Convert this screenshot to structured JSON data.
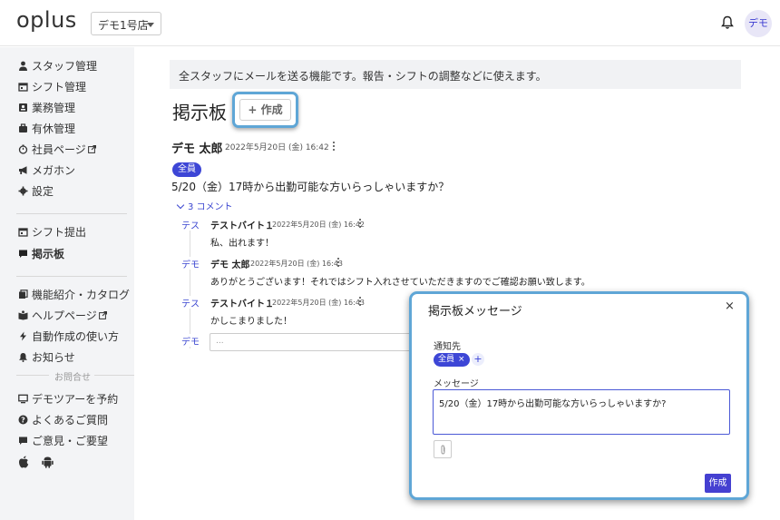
{
  "header": {
    "logo": "oplus",
    "store_select": "デモ1号店",
    "avatar": "デモ"
  },
  "sidebar": {
    "items_top": [
      {
        "label": "スタッフ管理",
        "icon": "person-icon"
      },
      {
        "label": "シフト管理",
        "icon": "calendar-icon"
      },
      {
        "label": "業務管理",
        "icon": "id-card-icon"
      },
      {
        "label": "有休管理",
        "icon": "briefcase-icon"
      },
      {
        "label": "社員ページ",
        "icon": "stopwatch-icon",
        "external": true
      },
      {
        "label": "メガホン",
        "icon": "megaphone-icon"
      },
      {
        "label": "設定",
        "icon": "gear-icon"
      }
    ],
    "items_mid": [
      {
        "label": "シフト提出",
        "icon": "calendar-icon"
      },
      {
        "label": "掲示板",
        "icon": "chat-icon",
        "active": true
      }
    ],
    "items_bottom": [
      {
        "label": "機能紹介・カタログ",
        "icon": "catalog-icon"
      },
      {
        "label": "ヘルプページ",
        "icon": "book-icon",
        "external": true
      },
      {
        "label": "自動作成の使い方",
        "icon": "bolt-icon"
      },
      {
        "label": "お知らせ",
        "icon": "bell-icon"
      }
    ],
    "contact_label": "お問合せ",
    "items_contact": [
      {
        "label": "デモツアーを予約",
        "icon": "monitor-icon"
      },
      {
        "label": "よくあるご質問",
        "icon": "question-icon"
      },
      {
        "label": "ご意見・ご要望",
        "icon": "comment-icon"
      }
    ]
  },
  "main": {
    "notice": "全スタッフにメールを送る機能です。報告・シフトの調整などに使えます。",
    "title": "掲示板",
    "create_button": "+ 作成",
    "post": {
      "author": "デモ 太郎",
      "date": "2022年5月20日 (金) 16:42",
      "badge": "全員",
      "body": "5/20（金）17時から出勤可能な方いらっしゃいますか？",
      "comments_toggle": "3 コメント",
      "comments": [
        {
          "avatar": "テス",
          "author": "テストバイト１",
          "date": "2022年5月20日 (金) 16:42",
          "body": "私、出れます！"
        },
        {
          "avatar": "デモ",
          "author": "デモ 太郎",
          "date": "2022年5月20日 (金) 16:43",
          "body": "ありがとうございます！それではシフト入れさせていただきますのでご確認お願い致します。"
        },
        {
          "avatar": "テス",
          "author": "テストバイト１",
          "date": "2022年5月20日 (金) 16:43",
          "body": "かしこまりました！"
        }
      ],
      "reply_avatar": "デモ",
      "reply_placeholder": "..."
    }
  },
  "modal": {
    "title": "掲示板メッセージ",
    "close": "×",
    "recipients_label": "通知先",
    "recipient_chip": "全員",
    "chip_remove": "×",
    "add": "+",
    "message_label": "メッセージ",
    "message_value": "5/20（金）17時から出勤可能な方いらっしゃいますか?",
    "submit": "作成"
  },
  "colors": {
    "accent": "#3d46d6",
    "highlight_border": "#5fa6d6",
    "sidebar_bg": "#f3f4f6"
  }
}
